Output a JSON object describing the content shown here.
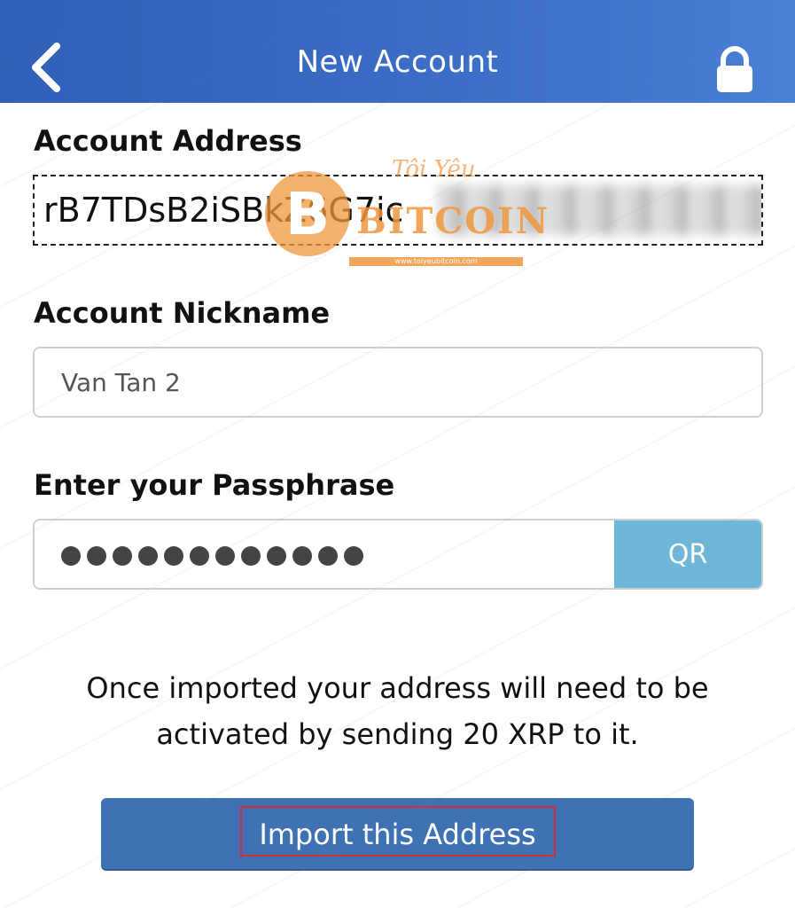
{
  "header": {
    "title": "New Account",
    "back_icon": "chevron-left-icon",
    "lock_icon": "lock-icon",
    "gradient_start": "#2f5fb8",
    "gradient_end": "#4a80d6"
  },
  "form": {
    "address_label": "Account Address",
    "address_value": "rB7TDsB2iSBkZ6G7ic",
    "nickname_label": "Account Nickname",
    "nickname_value": "Van Tan 2",
    "passphrase_label": "Enter your Passphrase",
    "passphrase_masked": "●●●●●●●●●●●●",
    "qr_label": "QR"
  },
  "notice": {
    "line1": "Once imported your address will need to be",
    "line2": "activated by sending 20 XRP to it."
  },
  "actions": {
    "import_label": "Import this Address",
    "accent": "#3f72b3",
    "highlight_color": "#d62b3a"
  },
  "watermark": {
    "logo_text": "BITCOIN",
    "logo_top": "Tôi Yêu",
    "logo_url": "www.toiyeubitcoin.com"
  }
}
